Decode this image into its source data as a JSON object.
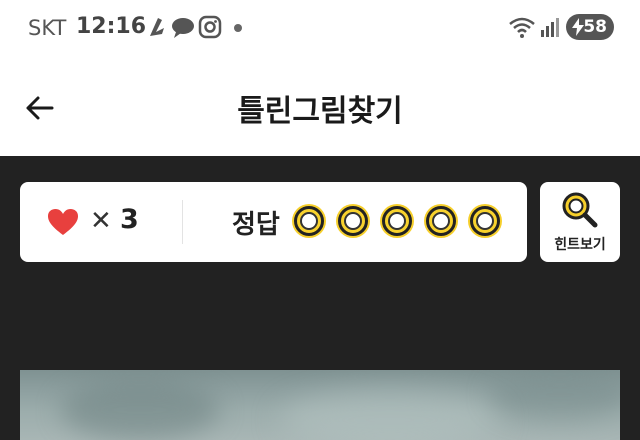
{
  "status_bar": {
    "carrier": "SKT",
    "time": "12:16",
    "battery": "58",
    "icons": [
      "notification-app-icon",
      "chat-bubble-icon",
      "instagram-icon",
      "dot-icon",
      "wifi-icon",
      "signal-icon",
      "battery-charging-icon"
    ]
  },
  "header": {
    "back_icon": "arrow-left-icon",
    "title": "틀린그림찾기"
  },
  "game": {
    "lives_icon": "heart-icon",
    "times_symbol": "✕",
    "lives": "3",
    "answer_label": "정답",
    "answer_slots": [
      {
        "found": false
      },
      {
        "found": false
      },
      {
        "found": false
      },
      {
        "found": false
      },
      {
        "found": false
      }
    ],
    "hint_label": "힌트보기",
    "hint_icon": "magnifier-icon"
  },
  "colors": {
    "heart": "#e8403e",
    "slot": "#f6cf2b",
    "background": "#222222"
  }
}
